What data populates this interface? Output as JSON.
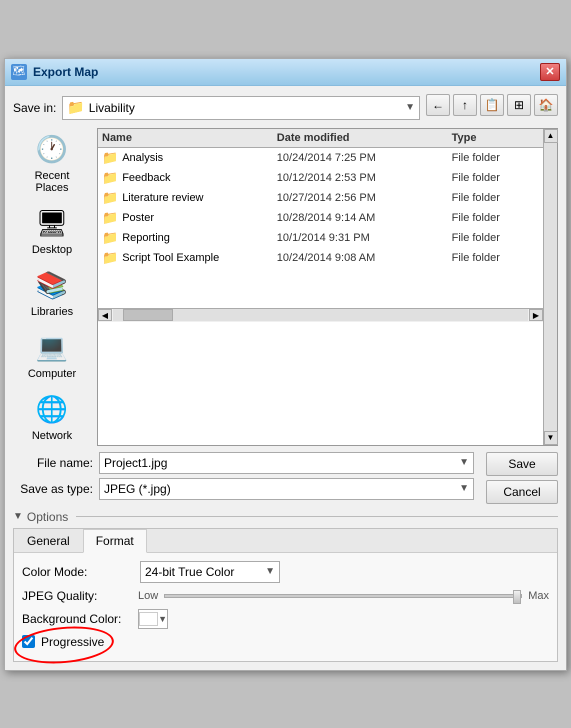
{
  "window": {
    "title": "Export Map",
    "close_icon": "✕"
  },
  "toolbar": {
    "save_in_label": "Save in:",
    "save_in_value": "Livability",
    "save_in_icon": "📁",
    "buttons": [
      "←",
      "→",
      "↑",
      "📋",
      "🏠"
    ]
  },
  "left_panel": {
    "items": [
      {
        "id": "recent-places",
        "label": "Recent Places",
        "icon": "🕐"
      },
      {
        "id": "desktop",
        "label": "Desktop",
        "icon": "🖥"
      },
      {
        "id": "libraries",
        "label": "Libraries",
        "icon": "📚"
      },
      {
        "id": "computer",
        "label": "Computer",
        "icon": "💻"
      },
      {
        "id": "network",
        "label": "Network",
        "icon": "🌐"
      }
    ]
  },
  "file_list": {
    "columns": [
      "Name",
      "Date modified",
      "Type"
    ],
    "files": [
      {
        "name": "Analysis",
        "date": "10/24/2014 7:25 PM",
        "type": "File folder"
      },
      {
        "name": "Feedback",
        "date": "10/12/2014 2:53 PM",
        "type": "File folder"
      },
      {
        "name": "Literature review",
        "date": "10/27/2014 2:56 PM",
        "type": "File folder"
      },
      {
        "name": "Poster",
        "date": "10/28/2014 9:14 AM",
        "type": "File folder"
      },
      {
        "name": "Reporting",
        "date": "10/1/2014 9:31 PM",
        "type": "File folder"
      },
      {
        "name": "Script Tool Example",
        "date": "10/24/2014 9:08 AM",
        "type": "File folder"
      }
    ]
  },
  "bottom_fields": {
    "filename_label": "File name:",
    "filename_value": "Project1.jpg",
    "savetype_label": "Save as type:",
    "savetype_value": "JPEG (*.jpg)"
  },
  "action_buttons": {
    "save": "Save",
    "cancel": "Cancel"
  },
  "options": {
    "header": "Options",
    "tabs": [
      "General",
      "Format"
    ],
    "active_tab": "Format",
    "color_mode_label": "Color Mode:",
    "color_mode_value": "24-bit True Color",
    "jpeg_quality_label": "JPEG Quality:",
    "jpeg_low": "Low",
    "jpeg_max": "Max",
    "bg_color_label": "Background Color:",
    "progressive_label": "Progressive",
    "progressive_checked": true
  }
}
